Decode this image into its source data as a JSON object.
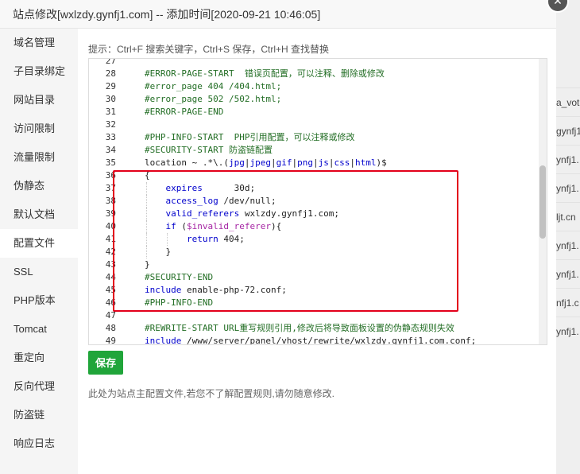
{
  "window": {
    "title": "站点修改[wxlzdy.gynfj1.com] -- 添加时间[2020-09-21 10:46:05]"
  },
  "background_rows": [
    "a_vot",
    "gynfj1",
    "ynfj1.",
    "ynfj1.",
    "ljt.cn",
    "ynfj1.",
    "ynfj1.",
    "nfj1.c",
    "ynfj1."
  ],
  "sidebar": {
    "items": [
      {
        "label": "域名管理"
      },
      {
        "label": "子目录绑定"
      },
      {
        "label": "网站目录"
      },
      {
        "label": "访问限制"
      },
      {
        "label": "流量限制"
      },
      {
        "label": "伪静态"
      },
      {
        "label": "默认文档"
      },
      {
        "label": "配置文件",
        "active": true
      },
      {
        "label": "SSL"
      },
      {
        "label": "PHP版本"
      },
      {
        "label": "Tomcat"
      },
      {
        "label": "重定向"
      },
      {
        "label": "反向代理"
      },
      {
        "label": "防盗链"
      },
      {
        "label": "响应日志"
      }
    ]
  },
  "editor": {
    "hint": "提示：Ctrl+F 搜索关键字，Ctrl+S 保存，Ctrl+H 查找替换",
    "lines": [
      {
        "n": "27",
        "text": ""
      },
      {
        "n": "28",
        "text": "#ERROR-PAGE-START  错误页配置，可以注释、删除或修改",
        "type": "cmt"
      },
      {
        "n": "29",
        "text": "#error_page 404 /404.html;",
        "type": "cmt"
      },
      {
        "n": "30",
        "text": "#error_page 502 /502.html;",
        "type": "cmt"
      },
      {
        "n": "31",
        "text": "#ERROR-PAGE-END",
        "type": "cmt"
      },
      {
        "n": "32",
        "text": ""
      },
      {
        "n": "33",
        "text": "#PHP-INFO-START  PHP引用配置，可以注释或修改",
        "type": "cmt"
      },
      {
        "n": "34",
        "text": "#SECURITY-START 防盗链配置",
        "type": "cmt"
      },
      {
        "n": "35",
        "text": "location ~ .*\\.(jpg|jpeg|gif|png|js|css|html)$",
        "type": "loc"
      },
      {
        "n": "36",
        "text": "{"
      },
      {
        "n": "37",
        "text": "    expires      30d;",
        "type": "kwline",
        "kw": "expires",
        "rest": "      30d;",
        "indent": 1
      },
      {
        "n": "38",
        "text": "    access_log /dev/null;",
        "type": "kwline",
        "kw": "access_log",
        "rest": " /dev/null;",
        "indent": 1
      },
      {
        "n": "39",
        "text": "    valid_referers wxlzdy.gynfj1.com;",
        "type": "kwline",
        "kw": "valid_referers",
        "rest": " wxlzdy.gynfj1.com;",
        "indent": 1
      },
      {
        "n": "40",
        "text": "    if ($invalid_referer){",
        "type": "ifline",
        "indent": 1
      },
      {
        "n": "41",
        "text": "        return 404;",
        "type": "kwline",
        "kw": "return",
        "rest": " 404;",
        "indent": 2
      },
      {
        "n": "42",
        "text": "    }",
        "indent": 1
      },
      {
        "n": "43",
        "text": "}"
      },
      {
        "n": "44",
        "text": "#SECURITY-END",
        "type": "cmt"
      },
      {
        "n": "45",
        "text": "include enable-php-72.conf;",
        "type": "kwline",
        "kw": "include",
        "rest": " enable-php-72.conf;",
        "indent": 0
      },
      {
        "n": "46",
        "text": "#PHP-INFO-END",
        "type": "cmt"
      },
      {
        "n": "47",
        "text": ""
      },
      {
        "n": "48",
        "text": "#REWRITE-START URL重写规则引用,修改后将导致面板设置的伪静态规则失效",
        "type": "cmt"
      },
      {
        "n": "49",
        "text": "include /www/server/panel/vhost/rewrite/wxlzdy.gynfj1.com.conf;",
        "type": "kwline",
        "kw": "include",
        "rest": " /www/server/panel/vhost/rewrite/wxlzdy.gynfj1.com.conf;",
        "indent": 0
      }
    ]
  },
  "actions": {
    "save_label": "保存"
  },
  "note": "此处为站点主配置文件,若您不了解配置规则,请勿随意修改.",
  "colors": {
    "accent": "#20a53a",
    "highlight_box": "#e3001b",
    "comment": "#236e25",
    "keyword": "#0000cc"
  }
}
